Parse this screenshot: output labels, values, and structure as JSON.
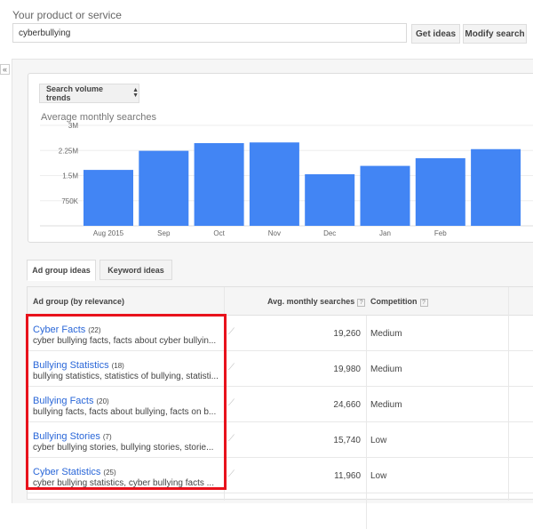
{
  "search": {
    "label": "Your product or service",
    "value": "cyberbullying",
    "get_ideas": "Get ideas",
    "modify_search": "Modify search"
  },
  "collapse": "«",
  "trend_select": "Search volume trends",
  "chart_data": {
    "type": "bar",
    "title": "Average monthly searches",
    "categories": [
      "Aug 2015",
      "Sep",
      "Oct",
      "Nov",
      "Dec",
      "Jan",
      "Feb",
      ""
    ],
    "values": [
      1670000,
      2240000,
      2470000,
      2490000,
      1540000,
      1790000,
      2020000,
      2290000
    ],
    "yticks": [
      "3M",
      "2.25M",
      "1.5M",
      "750K"
    ],
    "ylim": [
      0,
      3000000
    ],
    "grid": true,
    "color": "#4285f4"
  },
  "tabs": [
    "Ad group ideas",
    "Keyword ideas"
  ],
  "table": {
    "headers": {
      "group": "Ad group (by relevance)",
      "searches": "Avg. monthly searches",
      "competition": "Competition",
      "help": "?"
    },
    "rows": [
      {
        "name": "Cyber Facts",
        "count": "(22)",
        "keywords": "cyber bullying facts, facts about cyber bullyin...",
        "searches": "19,260",
        "competition": "Medium"
      },
      {
        "name": "Bullying Statistics",
        "count": "(18)",
        "keywords": "bullying statistics, statistics of bullying, statisti...",
        "searches": "19,980",
        "competition": "Medium"
      },
      {
        "name": "Bullying Facts",
        "count": "(20)",
        "keywords": "bullying facts, facts about bullying, facts on b...",
        "searches": "24,660",
        "competition": "Medium"
      },
      {
        "name": "Bullying Stories",
        "count": "(7)",
        "keywords": "cyber bullying stories, bullying stories, storie...",
        "searches": "15,740",
        "competition": "Low"
      },
      {
        "name": "Cyber Statistics",
        "count": "(25)",
        "keywords": "cyber bullying statistics, cyber bullying facts ...",
        "searches": "11,960",
        "competition": "Low"
      }
    ]
  },
  "highlight_color": "#e8121c"
}
